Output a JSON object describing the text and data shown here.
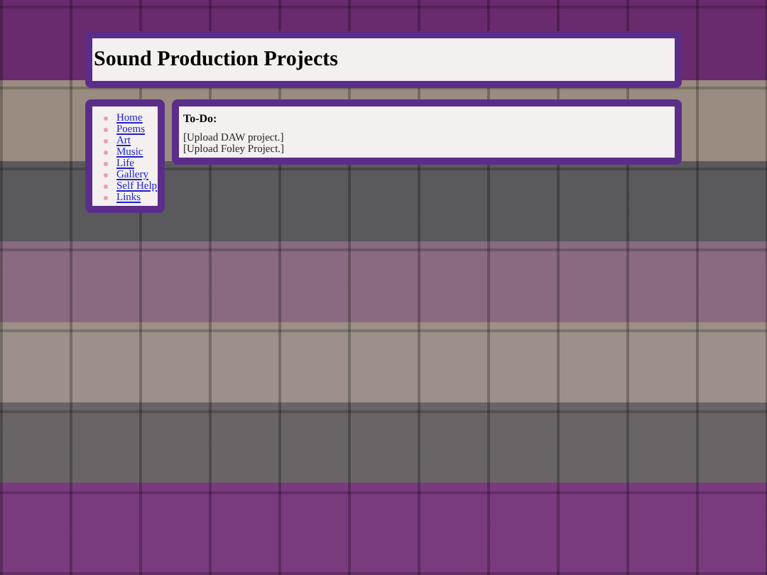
{
  "header": {
    "title": "Sound Production Projects"
  },
  "nav": {
    "links": [
      {
        "label": "Home"
      },
      {
        "label": "Poems"
      },
      {
        "label": "Art"
      },
      {
        "label": "Music"
      },
      {
        "label": "Life"
      },
      {
        "label": "Gallery"
      },
      {
        "label": "Self Help"
      },
      {
        "label": "Links"
      }
    ]
  },
  "content": {
    "heading": "To-Do:",
    "items": [
      "[Upload DAW project.]",
      "[Upload Foley Project.]"
    ]
  }
}
